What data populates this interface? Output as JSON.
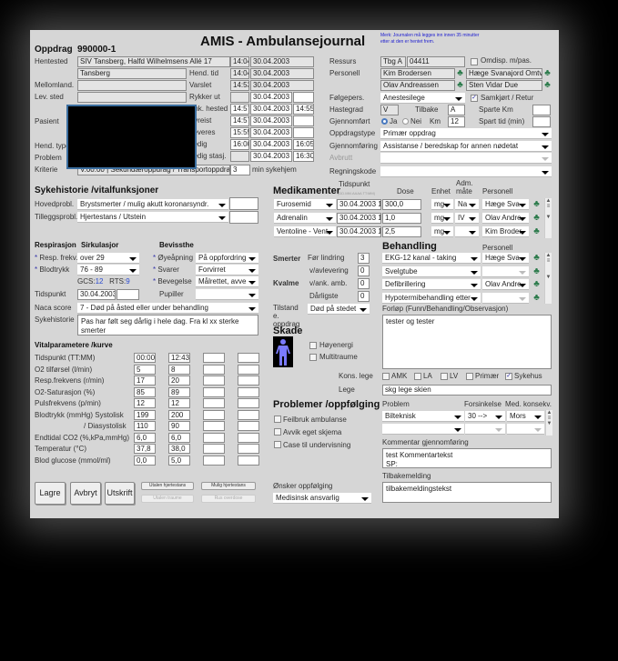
{
  "title": "AMIS - Ambulansejournal",
  "notice": "Merk: Journalen må legges inn innen 35 minutter etter at den er hentet frem.",
  "oppdrag": {
    "label": "Oppdrag",
    "number": "990000-1"
  },
  "left": {
    "hentested_label": "Hentested",
    "hentested": "SIV Tansberg, Halfd Wilhelmsens Allé 17",
    "hentested2": "Tansberg",
    "mellomland_label": "Mellomland.",
    "levsted_label": "Lev. sted",
    "pasient_label": "Pasient",
    "hendtype_label": "Hend. type",
    "problem_label": "Problem",
    "kriterie_label": "Kriterie",
    "kriterie": "V.00.00 | Sekundæroppdrag / Transportoppdrag",
    "minutes": "3",
    "min_label": "min",
    "sykehjem": "sykehjem"
  },
  "times": {
    "rows": [
      {
        "label": "",
        "time": "14:04",
        "date": "30.04.2003",
        "extra": ""
      },
      {
        "label": "Hend. tid",
        "time": "14:04",
        "date": "30.04.2003",
        "extra": ""
      },
      {
        "label": "Varslet",
        "time": "14:53",
        "date": "30.04.2003",
        "extra": ""
      },
      {
        "label": "Rykker ut",
        "time": "",
        "date": "30.04.2003",
        "extra": ""
      },
      {
        "label": "Ank. hested",
        "time": "14:57",
        "date": "30.04.2003",
        "extra": "14:55"
      },
      {
        "label": "Avreist",
        "time": "14:57",
        "date": "30.04.2003",
        "extra": ""
      },
      {
        "label": "Leveres",
        "time": "15:55",
        "date": "30.04.2003",
        "extra": ""
      },
      {
        "label": "Ledig",
        "time": "16:00",
        "date": "30.04.2003",
        "extra": "16:05"
      },
      {
        "label": "Ledig stasj.",
        "time": "",
        "date": "30.04.2003",
        "extra": "16:30"
      }
    ]
  },
  "right": {
    "ressurs_label": "Ressurs",
    "ressurs1": "Tbg A",
    "ressurs2": "04411",
    "omdisp": "Omdisp. m/pas.",
    "personell_label": "Personell",
    "personell": [
      "Kim Brodersen",
      "Hæge Svanajord Omtv",
      "Olav Andreassen",
      "Sten Vidar Due"
    ],
    "folgepers_label": "Følgepers.",
    "folgepers": "Anestesilege",
    "samkjort": "Samkjørt / Retur",
    "hastegrad_label": "Hastegrad",
    "hastegrad": "V",
    "tilbake_label": "Tilbake",
    "tilbake": "A",
    "sparte_km": "Sparte Km",
    "gjennomfort_label": "Gjennomført",
    "ja": "Ja",
    "nei": "Nei",
    "km_label": "Km",
    "km": "12",
    "spart_tid": "Spart tid (min)",
    "oppdragstype_label": "Oppdragstype",
    "oppdragstype": "Primær oppdrag",
    "gjennomforing_label": "Gjennomføring",
    "gjennomforing": "Assistanse / beredskap for annen nødetat",
    "avbrutt_label": "Avbrutt",
    "regningskode_label": "Regningskode"
  },
  "syk": {
    "title": "Sykehistorie /vitalfunksjoner",
    "hovedprobl_label": "Hovedprobl.",
    "hovedprobl": "Brystsmerter / mulig akutt koronarsyndr.",
    "tilleggsprobl_label": "Tilleggsprobl.",
    "tilleggsprobl": "Hjertestans / Utstein",
    "resp_title": "Respirasjon",
    "sirk_title": "Sirkulasjor",
    "bev_title": "Bevissthe",
    "respfrekv_label": "Resp. frekv.",
    "respfrekv": "over 29",
    "blodtrykk_label": "Blodtrykk",
    "blodtrykk": "76 - 89",
    "gcs_label": "GCS:",
    "gcs": "12",
    "rts_label": "RTS:",
    "rts": "9",
    "tidspunkt_label": "Tidspunkt",
    "tidspunkt": "30.04.2003",
    "oye_label": "Øyeåpning",
    "oye": "På oppfordring",
    "svarer_label": "Svarer",
    "svarer": "Forvirret",
    "bevegelse_label": "Bevegelse",
    "bevegelse": "Målrettet, avve",
    "pupiller_label": "Pupiller",
    "naca_label": "Naca score",
    "naca": "7 - Død på åsted eller under behandling",
    "sykehistorie_label": "Sykehistorie",
    "sykehistorie": "Pas har følt seg dårlig i hele dag. Fra kl xx sterke smerter"
  },
  "vital": {
    "title": "Vitalparametere /kurve",
    "rows": [
      {
        "label": "Tidspunkt (TT:MM)",
        "v": [
          "00:00",
          "12:43",
          "",
          ""
        ]
      },
      {
        "label": "O2 tilførsel (l/min)",
        "v": [
          "5",
          "8",
          "",
          ""
        ]
      },
      {
        "label": "Resp.frekvens (r/min)",
        "v": [
          "17",
          "20",
          "",
          ""
        ]
      },
      {
        "label": "O2-Saturasjon (%)",
        "v": [
          "85",
          "89",
          "",
          ""
        ]
      },
      {
        "label": "Pulsfrekvens (p/min)",
        "v": [
          "12",
          "12",
          "",
          ""
        ]
      },
      {
        "label": "Blodtrykk (mmHg)   Systolisk",
        "v": [
          "199",
          "200",
          "",
          ""
        ]
      },
      {
        "label": "/ Diasystolisk",
        "v": [
          "110",
          "90",
          "",
          ""
        ]
      },
      {
        "label": "Endtidal CO2 (%,kPa,mmHg)",
        "v": [
          "6,0",
          "6,0",
          "",
          ""
        ]
      },
      {
        "label": "Temperatur (°C)",
        "v": [
          "37,8",
          "38,0",
          "",
          ""
        ]
      },
      {
        "label": "Blod glucose (mmol/ml)",
        "v": [
          "0,0",
          "5,0",
          "",
          ""
        ]
      }
    ]
  },
  "buttons": {
    "lagre": "Lagre",
    "avbryt": "Avbryt",
    "utskrift": "Utskrift",
    "small": [
      "Utalen hjertestans",
      "Mulig hjertestans",
      "Utalen traume",
      "Rus overdose"
    ]
  },
  "med": {
    "title": "Medikamenter",
    "h_tid": "Tidspunkt",
    "h_tidfmt": "(DD.MM.AAAA TT:MM)",
    "h_dose": "Dose",
    "h_enhet": "Enhet",
    "h_adm": "Adm. måte",
    "h_pers": "Personell",
    "rows": [
      {
        "name": "Furosemid",
        "tid": "30.04.2003 12:00",
        "dose": "300,0",
        "enhet": "mg",
        "adm": "Na",
        "pers": "Hæge Sva"
      },
      {
        "name": "Adrenalin",
        "tid": "30.04.2003 12:00",
        "dose": "1,0",
        "enhet": "mg",
        "adm": "IV",
        "pers": "Olav Andre"
      },
      {
        "name": "Ventoline - Vent",
        "tid": "30.04.2003 12:00",
        "dose": "2,5",
        "enhet": "mg",
        "adm": "",
        "pers": "Kim Broder"
      }
    ]
  },
  "beh": {
    "title": "Behandling",
    "h_pers": "Personell",
    "rows": [
      {
        "name": "EKG-12 kanal - taking",
        "pers": "Hæge Sva"
      },
      {
        "name": "Svelgtube",
        "pers": ""
      },
      {
        "name": "Defibrillering",
        "pers": "Olav Andre"
      },
      {
        "name": "Hypotermibehandling etter",
        "pers": ""
      }
    ]
  },
  "smerter": {
    "smerter_label": "Smerter",
    "kvalme_label": "Kvalme",
    "rows": [
      {
        "label": "Før lindring",
        "v": "3"
      },
      {
        "label": "v/avlevering",
        "v": "0"
      },
      {
        "label": "v/ank. amb.",
        "v": "0"
      },
      {
        "label": "Dårligste",
        "v": "0"
      }
    ],
    "tilstand_label": "Tilstand e. oppdrag",
    "tilstand": "Død på stedet"
  },
  "forlop": {
    "label": "Forløp (Funn/Behandling/Observasjon)",
    "text": "tester og tester"
  },
  "skade": {
    "title": "Skade",
    "hoyenergi": "Høyenergi",
    "multitraume": "Multitraume"
  },
  "kons": {
    "label": "Kons. lege",
    "options": [
      "AMK",
      "LA",
      "LV",
      "Primær",
      "Sykehus"
    ],
    "checked": "Sykehus",
    "lege_label": "Lege",
    "lege": "skg lege skien"
  },
  "prob": {
    "title": "Problemer /oppfølging",
    "checks": [
      "Feilbruk ambulanse",
      "Avvik eget skjema",
      "Case til undervisning"
    ],
    "h_problem": "Problem",
    "h_fors": "Forsinkelse",
    "h_med": "Med. konsekv.",
    "rows": [
      {
        "problem": "Bilteknisk",
        "fors": "30 -->",
        "med": "Mors"
      },
      {
        "problem": "",
        "fors": "",
        "med": ""
      }
    ],
    "kommentar_label": "Kommentar gjennomføring",
    "kommentar": "test Kommentartekst\nSP:",
    "tilbake_label": "Tilbakemelding",
    "tilbake": "tilbakemeldingstekst",
    "onsker_label": "Ønsker oppfølging",
    "onsker": "Medisinsk ansvarlig"
  },
  "colors": {
    "panel": "#d6d6d6",
    "notice": "#2020d0",
    "gcs": "#2a4ad0"
  }
}
